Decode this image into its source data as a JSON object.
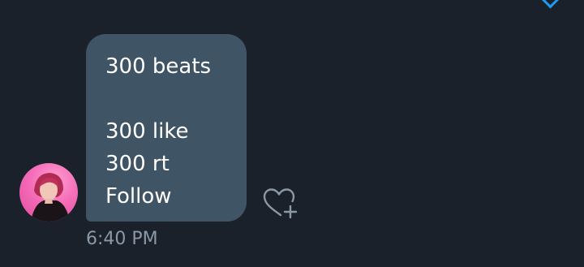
{
  "message": {
    "lines": [
      "300 beats",
      "",
      "300 like",
      "300 rt",
      "Follow"
    ],
    "timestamp": "6:40 PM"
  },
  "icons": {
    "reaction": "heart-plus-icon",
    "avatar": "user-avatar"
  },
  "colors": {
    "background": "#1a212b",
    "bubble": "#3f5465",
    "text": "#ffffff",
    "muted": "#8b98a5",
    "accent": "#1d9bf0"
  }
}
